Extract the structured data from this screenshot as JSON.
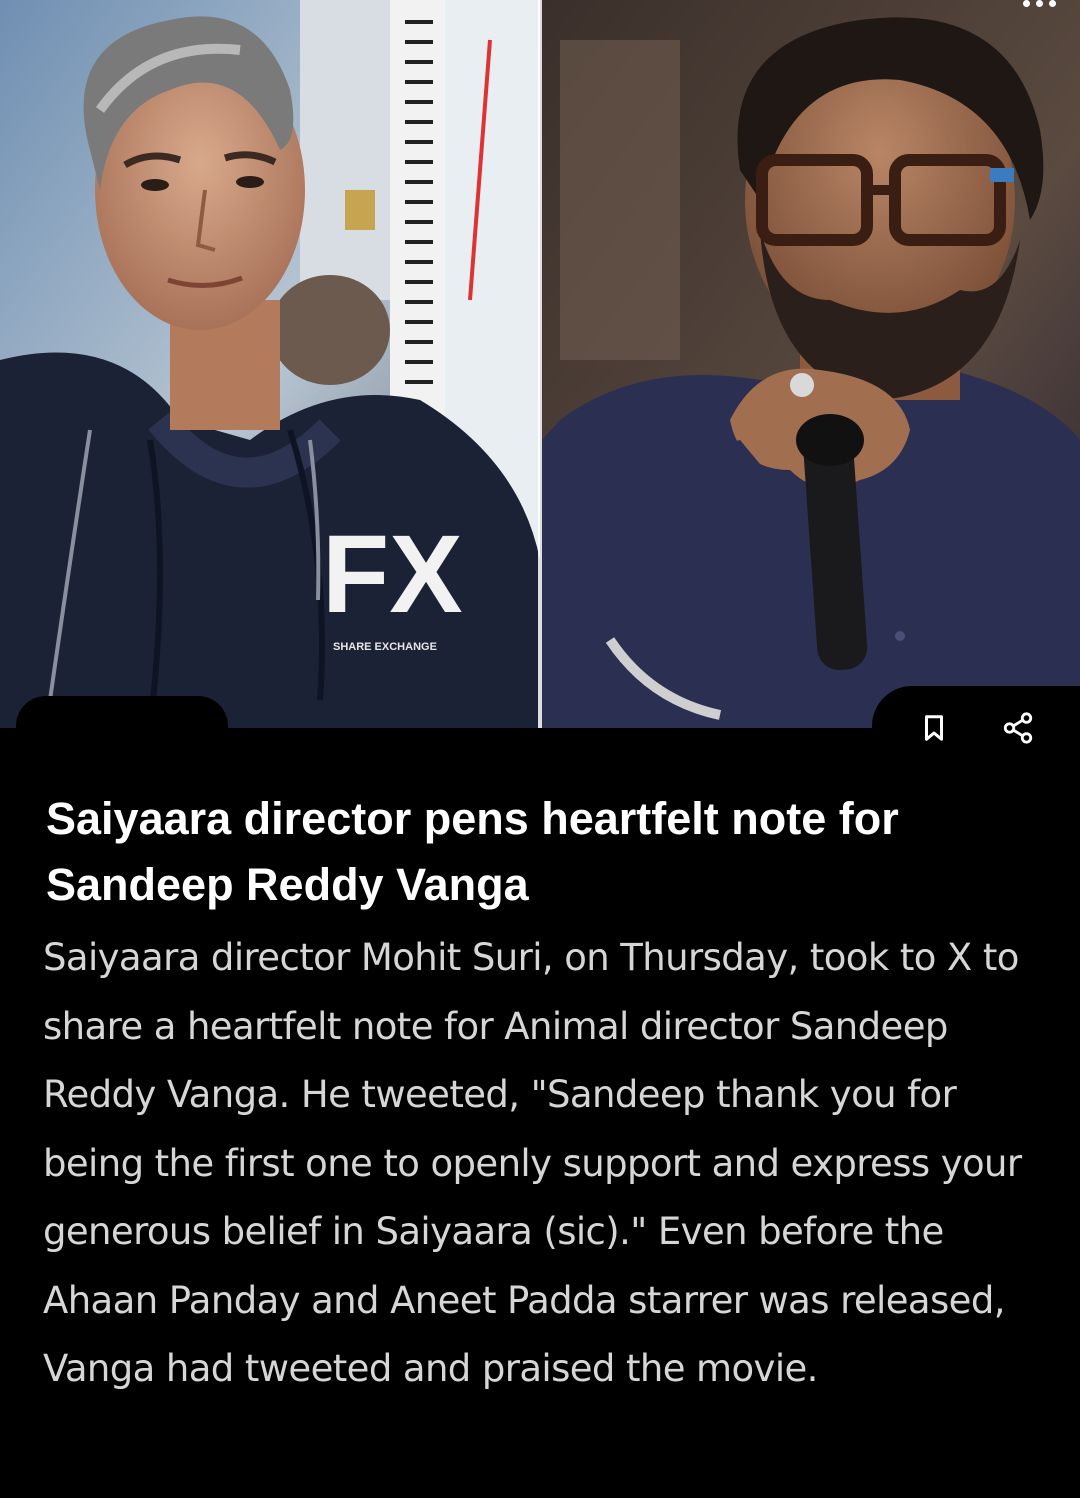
{
  "article": {
    "headline": "Saiyaara director pens heartfelt note for Sandeep Reddy Vanga",
    "body": "Saiyaara director Mohit Suri, on Thursday, took to X to share a heartfelt note for Animal director Sandeep Reddy Vanga. He tweeted, \"Sandeep thank you for being the first one to openly support and express your generous belief in Saiyaara (sic).\" Even before the Ahaan Panday and Aneet Padda starrer was released, Vanga had tweeted and praised the movie."
  },
  "photo": {
    "hoodie_logo": "FX",
    "hoodie_logo_subtext": "SHARE EXCHANGE"
  },
  "actions": {
    "bookmark_icon": "bookmark-icon",
    "share_icon": "share-icon",
    "more_icon": "more-dots-icon"
  },
  "colors": {
    "background": "#000000",
    "headline": "#ffffff",
    "body": "#d6d6d6"
  }
}
